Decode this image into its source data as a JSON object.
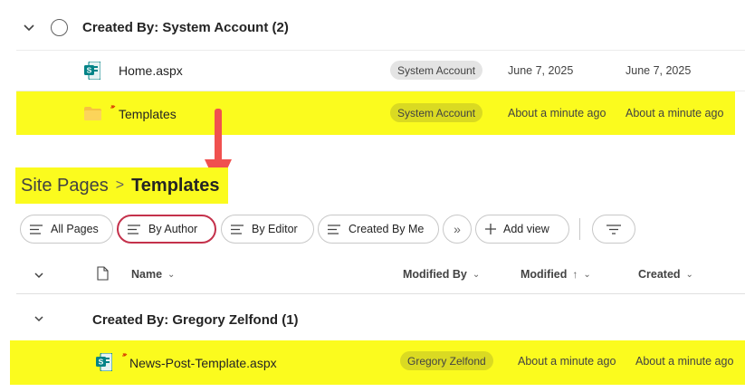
{
  "top": {
    "group_title": "Created By: System Account (2)",
    "rows": [
      {
        "name": "Home.aspx",
        "author": "System Account",
        "modified": "June 7, 2025",
        "created": "June 7, 2025",
        "icon": "sharepoint-page-icon"
      },
      {
        "name": "Templates",
        "author": "System Account",
        "modified": "About a minute ago",
        "created": "About a minute ago",
        "icon": "folder-icon"
      }
    ]
  },
  "breadcrumb": {
    "parent": "Site Pages",
    "separator": ">",
    "current": "Templates"
  },
  "toolbar": {
    "all_pages": "All Pages",
    "by_author": "By Author",
    "by_editor": "By Editor",
    "created_by_me": "Created By Me",
    "more": "»",
    "add_view": "Add view"
  },
  "columns": {
    "name": "Name",
    "modified_by": "Modified By",
    "modified": "Modified",
    "created": "Created"
  },
  "bottom": {
    "group_title": "Created By: Gregory Zelfond (1)",
    "row": {
      "name": "News-Post-Template.aspx",
      "author": "Gregory Zelfond",
      "modified": "About a minute ago",
      "created": "About a minute ago"
    }
  },
  "colors": {
    "highlight": "#fbfb1e",
    "arrow": "#f0514f",
    "active_border": "#c4314b",
    "sharepoint": "#038387"
  }
}
